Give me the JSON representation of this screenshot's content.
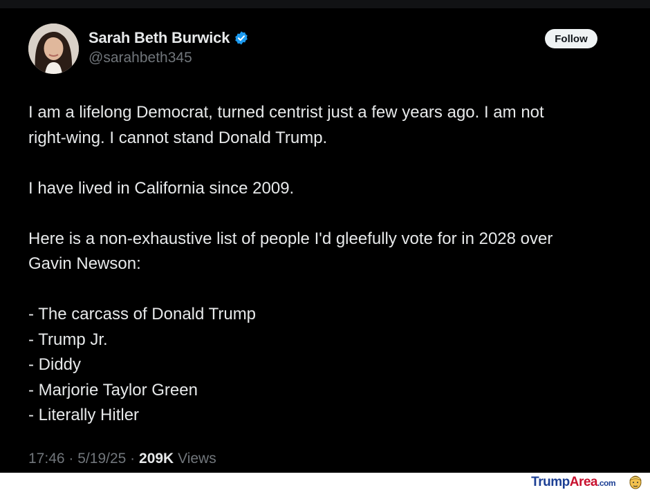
{
  "tweet": {
    "author_name": "Sarah Beth Burwick",
    "handle": "@sarahbeth345",
    "follow_label": "Follow",
    "body": {
      "p1_lines": [
        "I am a lifelong Democrat, turned centrist just a few years ago. I am not",
        "right-wing. I cannot stand Donald Trump."
      ],
      "p2": "I have lived in California since 2009.",
      "p3_lines": [
        "Here is a non-exhaustive list of people I'd gleefully vote for in 2028 over",
        "Gavin Newson:"
      ],
      "list": [
        "- The carcass of Donald Trump",
        "- Trump Jr.",
        "- Diddy",
        "- Marjorie Taylor Green",
        "- Literally Hitler"
      ]
    },
    "meta": {
      "time": "17:46",
      "separator": "·",
      "date": "5/19/25",
      "views_count": "209K",
      "views_label": "Views"
    }
  },
  "watermark": {
    "brand_part1": "Trump",
    "brand_part2": "Area",
    "brand_part3": ".com"
  },
  "icons": {
    "verified": "verified-badge-icon",
    "mascot": "trump-mascot-icon"
  },
  "colors": {
    "background": "#000000",
    "text": "#e7e9ea",
    "muted": "#71767b",
    "verified": "#1d9bf0",
    "follow_bg": "#eff3f4"
  }
}
